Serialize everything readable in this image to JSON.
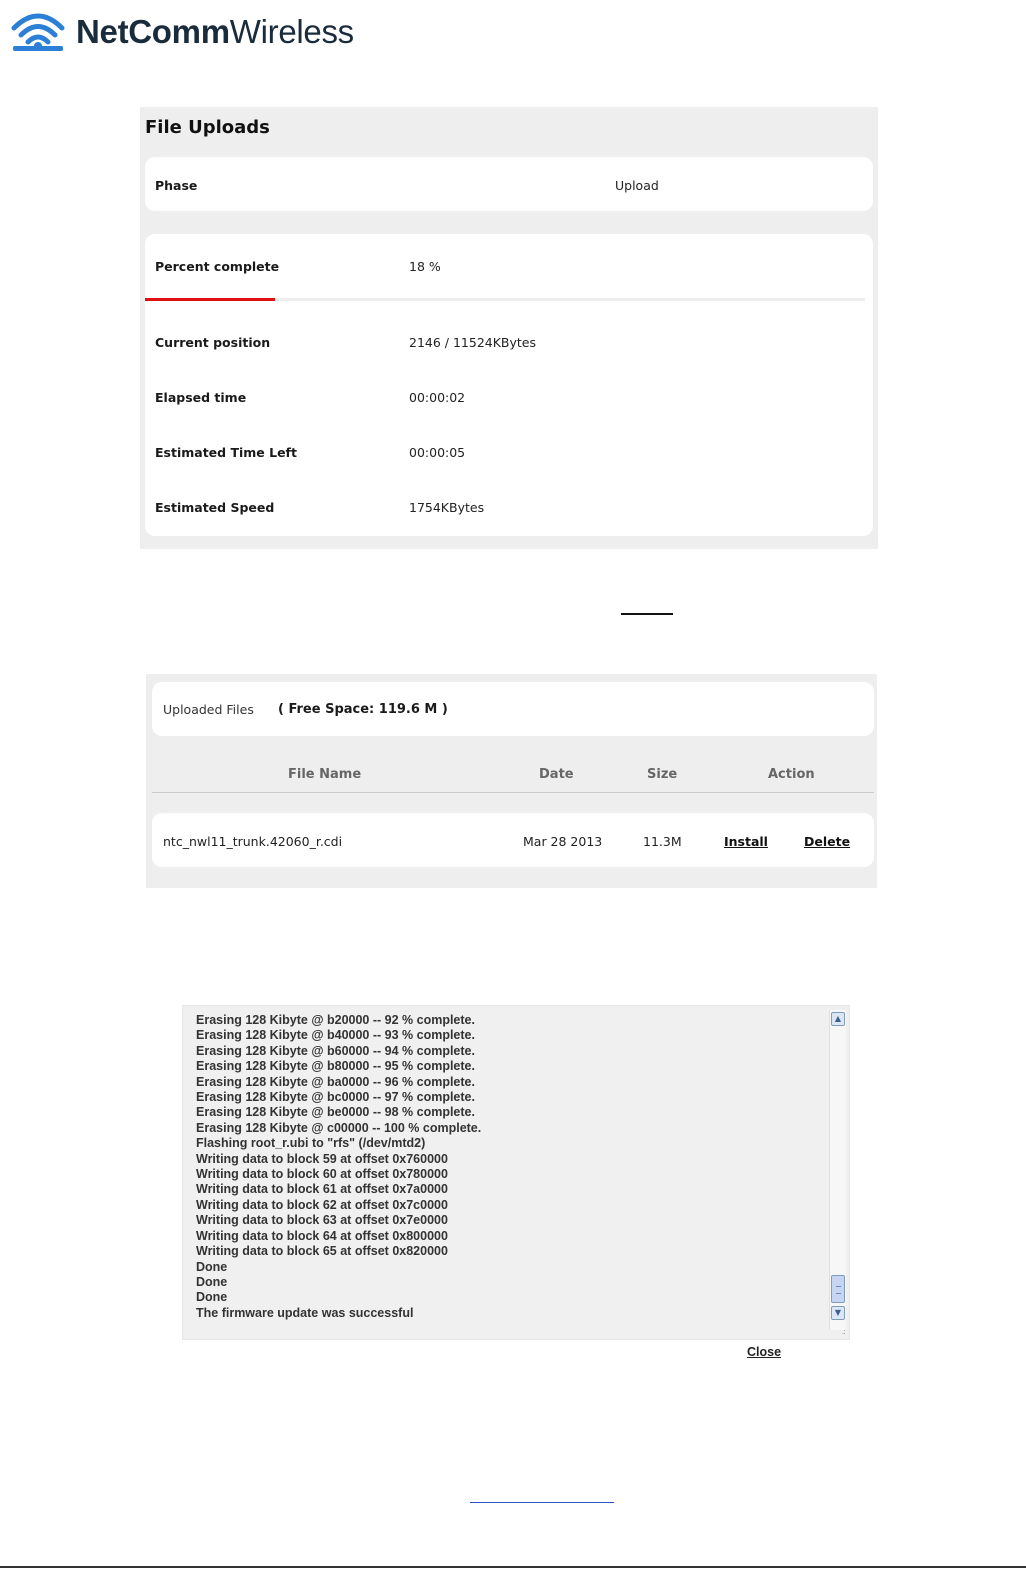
{
  "brand": {
    "name_bold": "NetComm",
    "name_light": "Wireless",
    "logo_icon": "wifi-signal-icon",
    "color": "#1a2b3c"
  },
  "file_uploads": {
    "title": "File Uploads",
    "phase_label": "Phase",
    "phase_value": "Upload",
    "percent_label": "Percent complete",
    "percent_value": "18 %",
    "percent_fraction": 0.18,
    "progress_color": "#dd1111",
    "rows": [
      {
        "label": "Current position",
        "value": "2146 / 11524KBytes"
      },
      {
        "label": "Elapsed time",
        "value": "00:00:02"
      },
      {
        "label": "Estimated Time Left",
        "value": "00:00:05"
      },
      {
        "label": "Estimated Speed",
        "value": "1754KBytes"
      }
    ]
  },
  "uploaded_files": {
    "title": "Uploaded Files",
    "free_space": "( Free Space: 119.6 M )",
    "columns": [
      "File Name",
      "Date",
      "Size",
      "Action"
    ],
    "files": [
      {
        "name": "ntc_nwl11_trunk.42060_r.cdi",
        "date": "Mar 28 2013",
        "size": "11.3M",
        "install": "Install",
        "delete": "Delete"
      }
    ]
  },
  "log": {
    "lines": [
      "Erasing 128 Kibyte @ b20000 -- 92 % complete.",
      "Erasing 128 Kibyte @ b40000 -- 93 % complete.",
      "Erasing 128 Kibyte @ b60000 -- 94 % complete.",
      "Erasing 128 Kibyte @ b80000 -- 95 % complete.",
      "Erasing 128 Kibyte @ ba0000 -- 96 % complete.",
      "Erasing 128 Kibyte @ bc0000 -- 97 % complete.",
      "Erasing 128 Kibyte @ be0000 -- 98 % complete.",
      "Erasing 128 Kibyte @ c00000 -- 100 % complete.",
      "Flashing root_r.ubi to \"rfs\" (/dev/mtd2)",
      "Writing data to block 59 at offset 0x760000",
      "Writing data to block 60 at offset 0x780000",
      "Writing data to block 61 at offset 0x7a0000",
      "Writing data to block 62 at offset 0x7c0000",
      "Writing data to block 63 at offset 0x7e0000",
      "Writing data to block 64 at offset 0x800000",
      "Writing data to block 65 at offset 0x820000",
      "Done",
      "Done",
      "Done",
      "The firmware update was successful"
    ],
    "close_label": "Close"
  }
}
